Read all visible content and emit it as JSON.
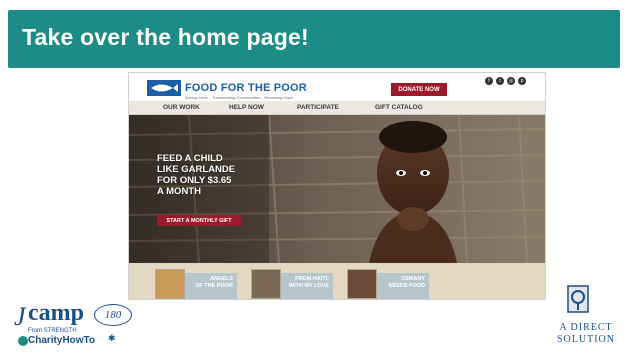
{
  "slide": {
    "title": "Take over the home page!"
  },
  "site": {
    "logo_text": "FOOD FOR THE POOR",
    "logo_tagline": "Saving Lives... Transforming Communities... Renewing Hope",
    "donate_label": "DONATE NOW",
    "social_icons": [
      "facebook-icon",
      "twitter-icon",
      "instagram-icon",
      "pinterest-icon"
    ],
    "nav": [
      "OUR WORK",
      "HELP NOW",
      "PARTICIPATE",
      "GIFT CATALOG"
    ],
    "hero": {
      "lines": [
        "FEED A CHILD",
        "LIKE GARLANDE",
        "FOR ONLY $3.65",
        "A MONTH"
      ],
      "button": "START A MONTHLY GIFT"
    },
    "cards": [
      {
        "lines": [
          "ANGELS",
          "OF THE POOR"
        ]
      },
      {
        "lines": [
          "FROM HAITI:",
          "WITH MY LOVE"
        ]
      },
      {
        "lines": [
          "OSMANY",
          "NEEDS FOOD"
        ]
      }
    ]
  },
  "footer": {
    "camp_word": "camp",
    "camp_number": "180",
    "camp_sub": "From STRENGTH",
    "camp_charity": "CharityHowTo",
    "ads_line1": "A DIRECT",
    "ads_line2": "SOLUTION"
  },
  "colors": {
    "title_bar": "#1e8c86",
    "donate": "#9b1b2a",
    "brand_blue": "#1b5fa8"
  }
}
